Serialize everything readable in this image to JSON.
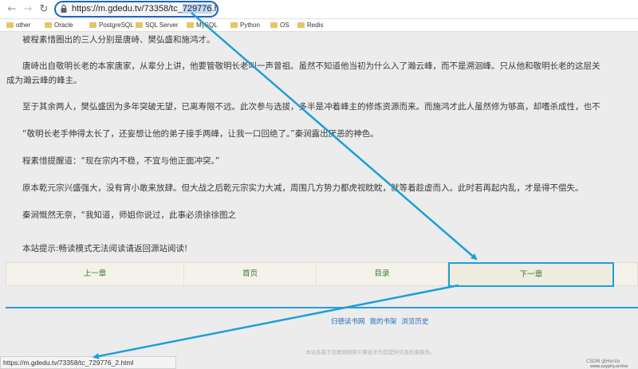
{
  "browser": {
    "url_prefix": "https://m.gdedu.tv/73358/tc_",
    "url_selected": "729776",
    "url_suffix": ".html"
  },
  "bookmarks": [
    "other",
    "Oracle",
    "PostgreSQL",
    "SQL Server",
    "MySQL",
    "Python",
    "OS",
    "Redis"
  ],
  "article": {
    "p1": "被程素惜圈出的三人分别是唐峙、樊弘盛和施鸿才。",
    "p2a": "唐峙出自敬明长老的本家唐家，从辈分上讲，他要管敬明长老叫一声曾祖。虽然不知道他当初为什么入了瀚云峰，而不是溯洄峰。只从他和敬明长老的这层关",
    "p2b": "成为瀚云峰的峰主。",
    "p3": "至于其余两人，樊弘盛因为多年突破无望，已离寿限不远。此次参与选拔，多半是冲着峰主的修炼资源而来。而施鸿才此人虽然修为够高，却嗜杀成性，也不",
    "p4": "“敬明长老手伸得太长了，还妄想让他的弟子接手两峰，让我一口回绝了。”秦涧露出厌恶的神色。",
    "p5": "程素惜提醒道：“现在宗内不稳，不宜与他正面冲突。”",
    "p6": "原本乾元宗兴盛强大，没有宵小敢来放肆。但大战之后乾元宗实力大减，周围几方势力都虎视眈眈，就等着趁虚而入。此时若再起内乱，才是得不偿失。",
    "p7": "秦涧慨然无奈，“我知道，师姐你说过，此事必须徐徐图之",
    "notice": "本站提示:畅读模式无法阅读请返回源站阅读!"
  },
  "pager": {
    "prev": "上一章",
    "home": "首页",
    "toc": "目录",
    "next": "下一章"
  },
  "footer": {
    "links": [
      "归德读书网",
      "我的书架",
      "浏览历史"
    ],
    "note": "本站系基于互联网搜索引擎技术为您提供信息检索服务。"
  },
  "statusbar": {
    "link_url": "https://m.gdedu.tv/73358/tc_729776_2.html"
  },
  "watermark": {
    "line1": "CSDN @Henlo",
    "line2": "www.xzyphy.online"
  },
  "colors": {
    "annotation": "#1e9fd6",
    "url_focus": "#1d63c4",
    "link_green": "#3a7a2a"
  }
}
